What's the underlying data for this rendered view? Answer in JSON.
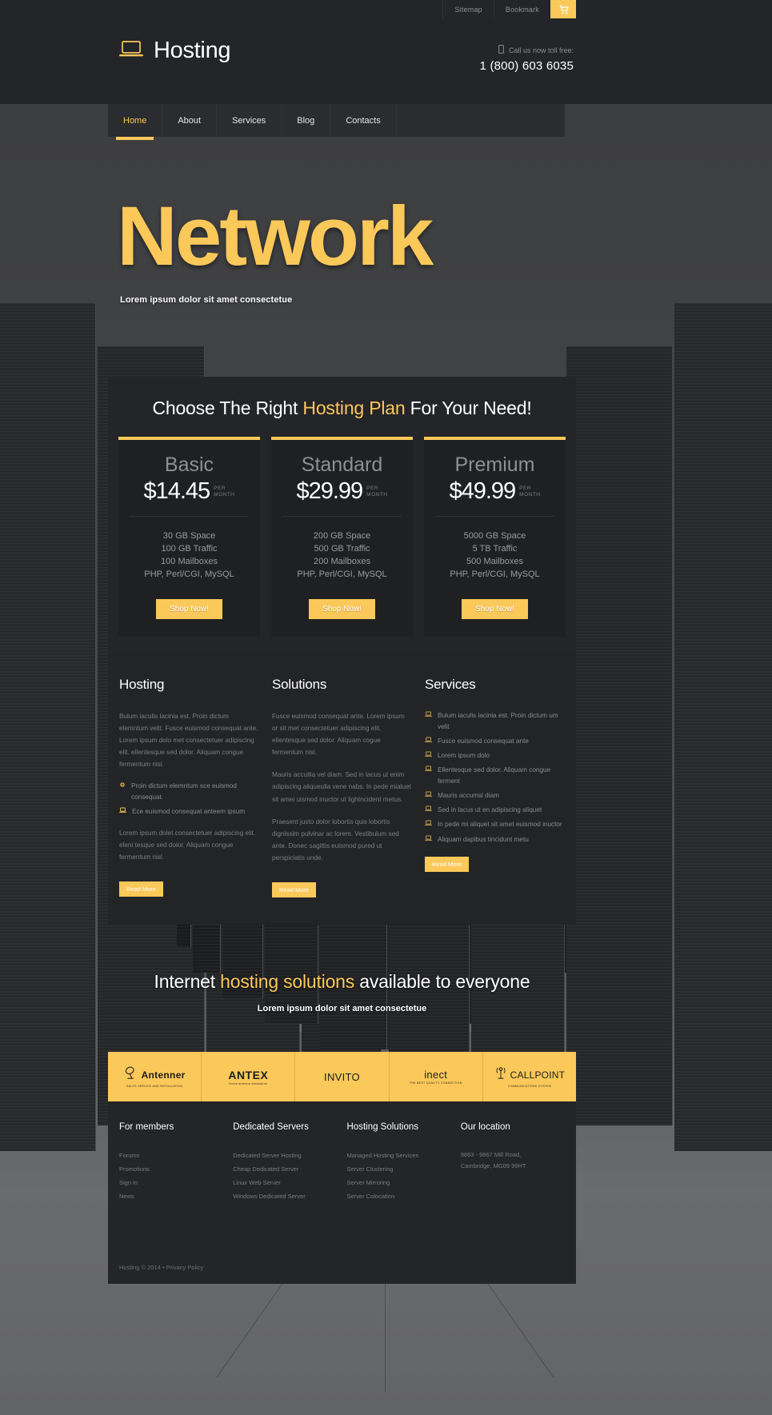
{
  "topbar": {
    "links": [
      {
        "label": "Sitemap",
        "name": "sitemap"
      },
      {
        "label": "Bookmark",
        "name": "bookmark"
      }
    ],
    "cart_icon": "cart-icon"
  },
  "header": {
    "logo_icon": "laptop-icon",
    "logo_text": "Hosting",
    "phone_icon": "mobile-phone-icon",
    "phone_label": "Call us now toll free:",
    "phone_number": "1 (800) 603 6035"
  },
  "nav": {
    "items": [
      {
        "label": "Home"
      },
      {
        "label": "About"
      },
      {
        "label": "Services"
      },
      {
        "label": "Blog"
      },
      {
        "label": "Contacts"
      }
    ],
    "active_index": 0
  },
  "hero": {
    "title": "Network",
    "subtitle": "Lorem ipsum dolor sit amet consectetue"
  },
  "pricing": {
    "heading_before": "Choose The Right ",
    "heading_highlight": "Hosting Plan",
    "heading_after": " For Your Need!",
    "per_line1": "PER",
    "per_line2": "MONTH",
    "plans": [
      {
        "name": "Basic",
        "price": "$14.45",
        "features": [
          "30 GB Space",
          "100 GB Traffic",
          "100 Mailboxes",
          "PHP, Perl/CGI, MySQL"
        ],
        "cta": "Shop Now!"
      },
      {
        "name": "Standard",
        "price": "$29.99",
        "features": [
          "200 GB Space",
          "500 GB Traffic",
          "200 Mailboxes",
          "PHP, Perl/CGI, MySQL"
        ],
        "cta": "Shop Now!"
      },
      {
        "name": "Premium",
        "price": "$49.99",
        "features": [
          "5000 GB Space",
          "5 TB Traffic",
          "500 Mailboxes",
          "PHP, Perl/CGI, MySQL"
        ],
        "cta": "Shop Now!"
      }
    ]
  },
  "content": {
    "hosting": {
      "title": "Hosting",
      "para1": "Bulum iaculis lacinia est. Proin dictum elemntum velit. Fusce euismod consequat ante. Lorem ipsum dolo met consectetuer adipiscing elit. ellentesque sed dolor. Aliquam congue fermentum nisl.",
      "items": [
        {
          "icon": "gear-icon",
          "text": "Proin dictum elemntum sce euismod consequat."
        },
        {
          "icon": "laptop-icon",
          "text": "Ece euismod consequat anteem ipsum"
        }
      ],
      "para2": "Lorem ipsum dolet consectetuer adipiscing elit. eleni tesque sed dolor. Aliquam congue fermentum nisl.",
      "readmore": "Read More"
    },
    "solutions": {
      "title": "Solutions",
      "para1": "Fusce euismod consequat ante. Lorem ipsum or sit met consectetuer adipiscing elit. elientesque sed dolor. Aliquam cogue fermentum nisl.",
      "para2": "Mauris accuilia vel diam. Sed in lacus ut enim adipiscing aliqueulla vene nabs. In pede mialuet sit amei uismod inuctor ut lightncident metus.",
      "para3": "Praesent justo dolor lobortis quis lobortis dignissim pulvinar ac lorem. Vestibulum sed ante. Donec sagittis euismod pured ut perspiciatis unde.",
      "readmore": "Read More"
    },
    "services": {
      "title": "Services",
      "items": [
        "Bulum iaculis lacinia est. Proin dictum um velit",
        "Fusce euismod consequat ante",
        "Lorem ipsum dolo",
        "Ellentesque sed dolor. Aliquam congue ferment",
        "Mauris accumsl diam",
        "Sed in lacus ut en adipiscing aliquet",
        "In pede mi aliquet sit amet euismod inuctor",
        "Aliquam dapibus tincidunt metu"
      ],
      "bullet_icon": "laptop-icon",
      "readmore": "Read More"
    }
  },
  "tagline": {
    "before": "Internet ",
    "highlight": "hosting solutions",
    "after": " available to everyone",
    "subtitle": "Lorem ipsum dolor sit amet consectetue"
  },
  "partners": [
    {
      "name": "Antenner",
      "tagline": "SALES SERVICE AND INSTALLATION",
      "icon": "satellite-dish-icon"
    },
    {
      "name": "ANTEX",
      "tagline": "Home antenna installation",
      "icon": ""
    },
    {
      "name": "INVITO",
      "tagline": "",
      "icon": ""
    },
    {
      "name": "inect",
      "tagline": "THE BEST QUALITY CONNECTION",
      "icon": ""
    },
    {
      "name": "CALLPOINT",
      "tagline": "COMMUNICATIONS SYSTEM",
      "icon": "antenna-tower-icon"
    }
  ],
  "footer": {
    "columns": [
      {
        "title": "For members",
        "links": [
          "Forums",
          "Promotions",
          "Sign in",
          "News"
        ]
      },
      {
        "title": "Dedicated Servers",
        "links": [
          "Dedicated Server Hosting",
          "Cheap Dedicated Server",
          "Linux Web Server",
          "Windows Dedicated Server"
        ]
      },
      {
        "title": "Hosting Solutions",
        "links": [
          "Managed Hosting Services",
          "Server Clustering",
          "Server Mirroring",
          "Server Colocation"
        ]
      }
    ],
    "location": {
      "title": "Our location",
      "address_line1": "9863 - 9867 Mill Road,",
      "address_line2": "Cambridge, MG09 99HT"
    },
    "copyright": "Hosting © 2014 • ",
    "privacy": "Privacy Policy"
  },
  "colors": {
    "accent": "#fbc85a",
    "panel": "#242528",
    "card": "#1f2022",
    "muted": "#8b8c8f"
  }
}
